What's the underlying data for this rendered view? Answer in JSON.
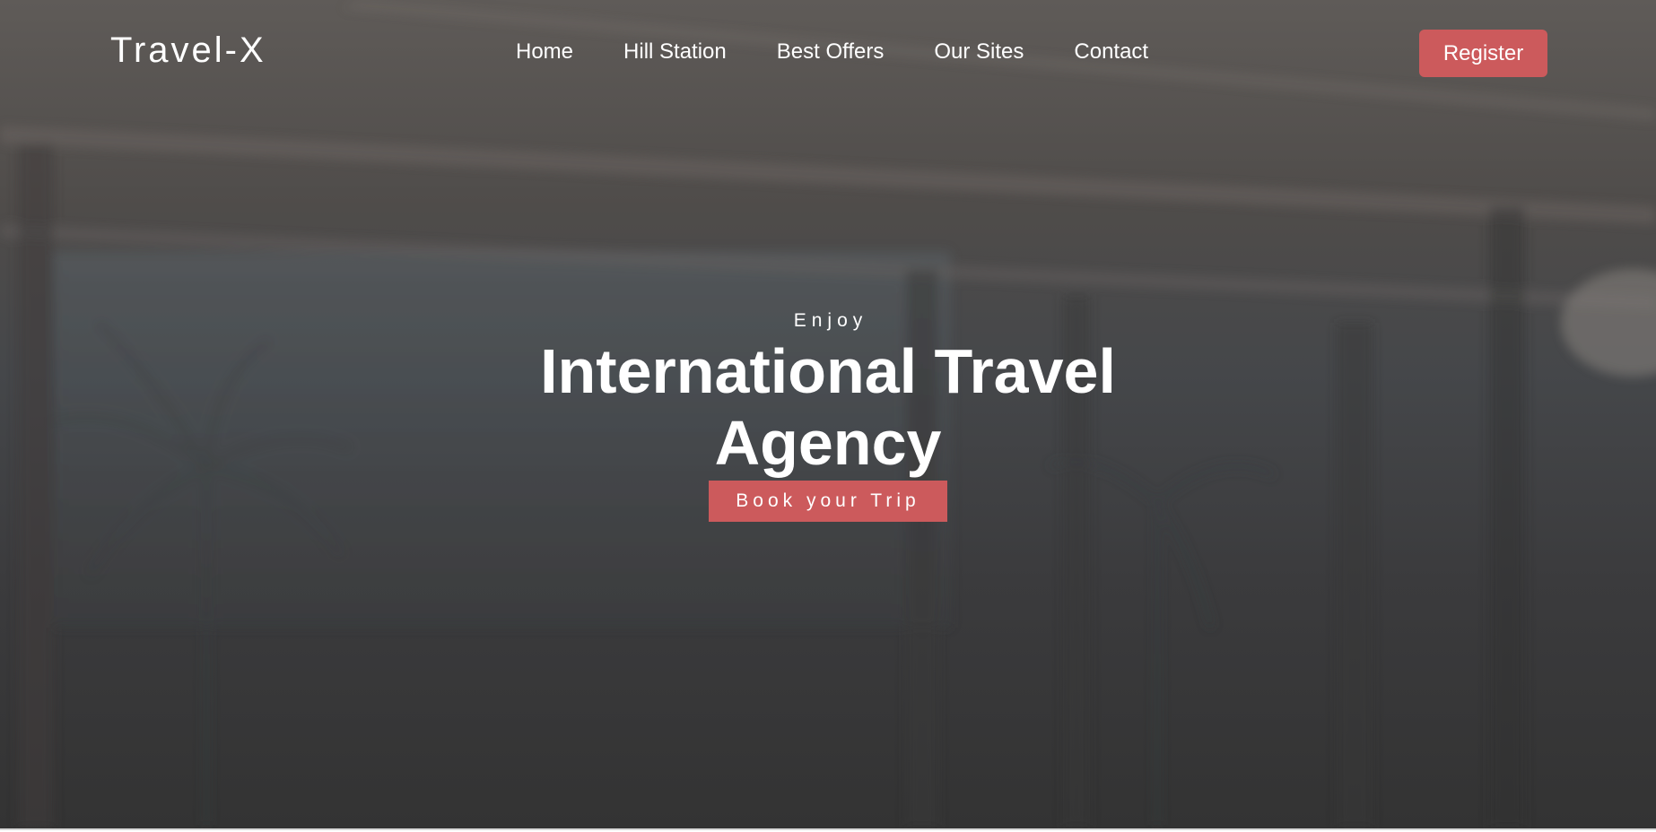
{
  "navbar": {
    "brand": "Travel-X",
    "links": [
      "Home",
      "Hill Station",
      "Best Offers",
      "Our Sites",
      "Contact"
    ],
    "register_label": "Register"
  },
  "hero": {
    "eyebrow": "Enjoy",
    "headline": "International Travel Agency",
    "cta_label": "Book your Trip"
  },
  "colors": {
    "accent": "#cc5a5c",
    "text": "#ffffff",
    "overlay_top": "#5f5b58",
    "overlay_bottom": "#333333"
  }
}
